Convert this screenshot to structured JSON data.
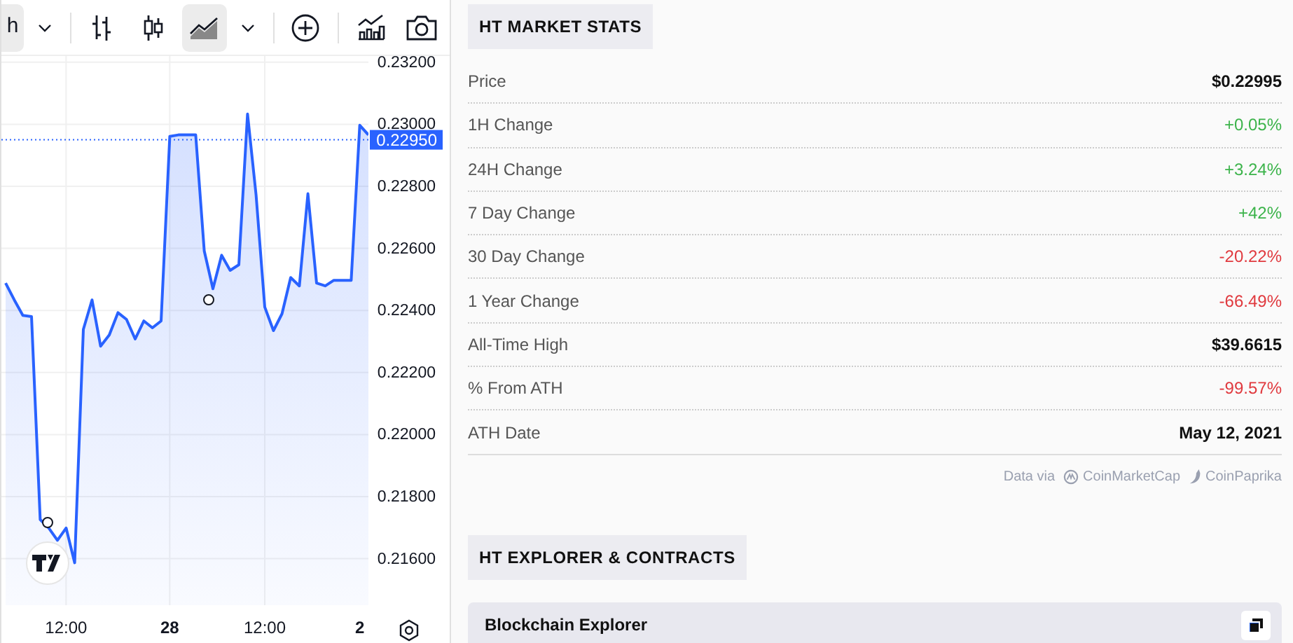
{
  "chart_panel": {
    "interval": {
      "label": "h",
      "selected": true
    },
    "chart_types": [
      {
        "kind": "bars",
        "selected": false
      },
      {
        "kind": "candles",
        "selected": false
      },
      {
        "kind": "area",
        "selected": true
      }
    ],
    "chart_data": {
      "type": "area",
      "grid": true,
      "ylim": [
        0.2145,
        0.2322
      ],
      "ref_lines": [
        {
          "value": 0.2295,
          "label": "0.22950",
          "color": "#2962ff",
          "axis": "y"
        }
      ],
      "categories": [
        null,
        null,
        null,
        null,
        null,
        null,
        null,
        "12:00",
        null,
        null,
        null,
        null,
        null,
        null,
        null,
        null,
        null,
        null,
        null,
        "28",
        null,
        null,
        null,
        null,
        null,
        null,
        null,
        null,
        null,
        null,
        "12:00",
        null,
        null,
        null,
        null,
        null,
        null,
        null,
        null,
        null,
        null,
        "2",
        null
      ],
      "series": [
        {
          "color": "#2962ff",
          "values": [
            0.22488,
            0.22434,
            0.22384,
            0.2238,
            0.21726,
            0.21699,
            0.21659,
            0.21699,
            0.21587,
            0.22339,
            0.22434,
            0.22285,
            0.22321,
            0.22393,
            0.22371,
            0.22308,
            0.22366,
            0.22344,
            0.22366,
            0.22961,
            0.22966,
            0.22966,
            0.22966,
            0.22592,
            0.2247,
            0.22578,
            0.22529,
            0.22547,
            0.23033,
            0.22772,
            0.22411,
            0.22335,
            0.22389,
            0.22506,
            0.22479,
            0.22776,
            0.22488,
            0.22479,
            0.22497,
            0.22497,
            0.22497,
            0.22997,
            0.22966
          ]
        }
      ],
      "yticks": [
        {
          "value": 0.232,
          "label": "0.23200"
        },
        {
          "value": 0.23,
          "label": "0.23000"
        },
        {
          "value": 0.228,
          "label": "0.22800"
        },
        {
          "value": 0.226,
          "label": "0.22600"
        },
        {
          "value": 0.224,
          "label": "0.22400"
        },
        {
          "value": 0.222,
          "label": "0.22200"
        },
        {
          "value": 0.22,
          "label": "0.22000"
        },
        {
          "value": 0.218,
          "label": "0.21800"
        },
        {
          "value": 0.216,
          "label": "0.21600"
        }
      ]
    }
  },
  "market_stats": {
    "title": "HT MARKET STATS",
    "rows": [
      {
        "label": "Price",
        "value": "$0.22995",
        "kind": "plain",
        "color": "#111111"
      },
      {
        "label": "1H Change",
        "value": "+0.05%",
        "kind": "change",
        "color": "#3bb34a"
      },
      {
        "label": "24H Change",
        "value": "+3.24%",
        "kind": "change",
        "color": "#3bb34a"
      },
      {
        "label": "7 Day Change",
        "value": "+42%",
        "kind": "change",
        "color": "#3bb34a"
      },
      {
        "label": "30 Day Change",
        "value": "-20.22%",
        "kind": "change",
        "color": "#e0393e"
      },
      {
        "label": "1 Year Change",
        "value": "-66.49%",
        "kind": "change",
        "color": "#e0393e"
      },
      {
        "label": "All-Time High",
        "value": "$39.6615",
        "kind": "plain",
        "color": "#111111"
      },
      {
        "label": "% From ATH",
        "value": "-99.57%",
        "kind": "change",
        "color": "#e0393e"
      },
      {
        "label": "ATH Date",
        "value": "May 12, 2021",
        "kind": "plain",
        "color": "#111111"
      }
    ],
    "source_label": "Data via",
    "sources": [
      "CoinMarketCap",
      "CoinPaprika"
    ]
  },
  "explorer": {
    "title": "HT EXPLORER & CONTRACTS",
    "items": [
      {
        "label": "Blockchain Explorer"
      }
    ]
  }
}
